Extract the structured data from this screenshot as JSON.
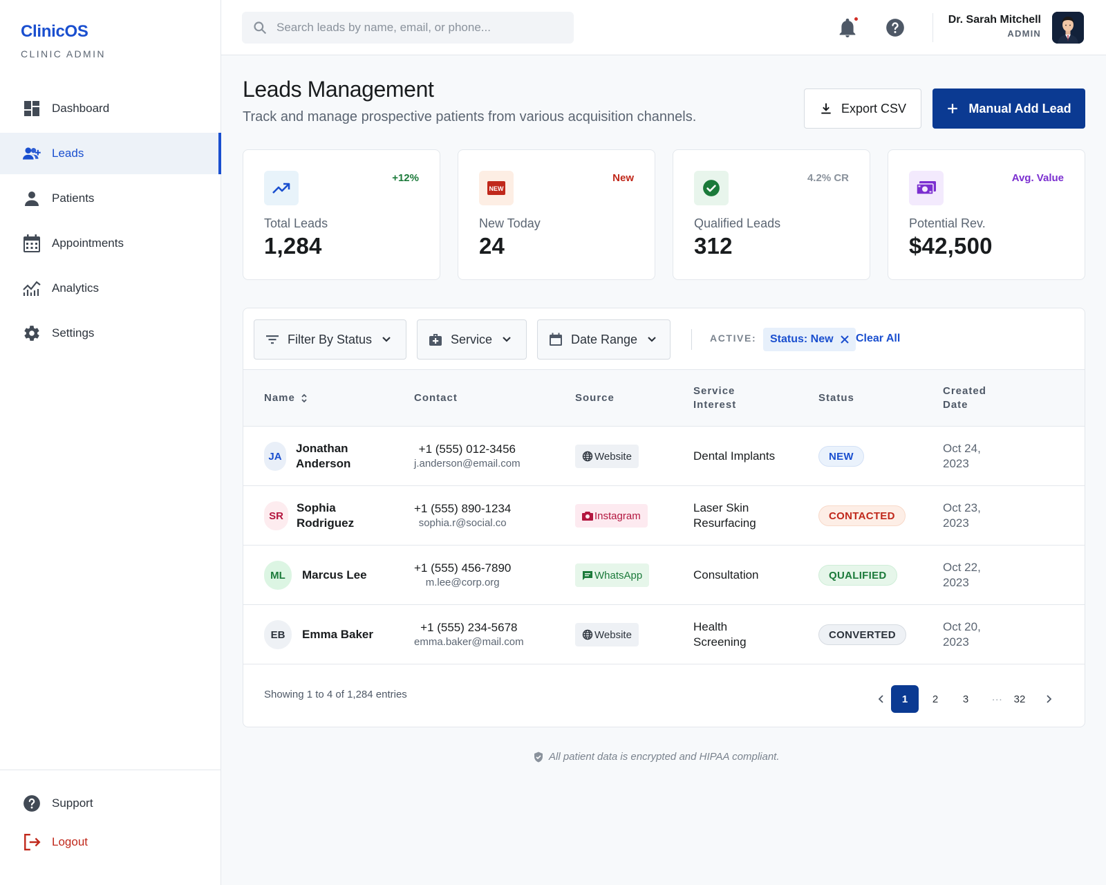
{
  "brand": {
    "title": "ClinicOS",
    "subtitle": "CLINIC ADMIN"
  },
  "sidebar": {
    "items": [
      {
        "label": "Dashboard",
        "icon": "dashboard-icon"
      },
      {
        "label": "Leads",
        "icon": "group-add-icon",
        "active": true
      },
      {
        "label": "Patients",
        "icon": "person-icon"
      },
      {
        "label": "Appointments",
        "icon": "calendar-icon"
      },
      {
        "label": "Analytics",
        "icon": "analytics-icon"
      },
      {
        "label": "Settings",
        "icon": "gear-icon"
      }
    ],
    "bottom": [
      {
        "label": "Support",
        "icon": "help-icon"
      },
      {
        "label": "Logout",
        "icon": "logout-icon"
      }
    ]
  },
  "topbar": {
    "search_placeholder": "Search leads by name, email, or phone...",
    "user_name": "Dr. Sarah Mitchell",
    "user_role": "ADMIN"
  },
  "header": {
    "title": "Leads Management",
    "subtitle": "Track and manage prospective patients from various acquisition channels.",
    "export_label": "Export CSV",
    "add_label": "Manual Add Lead"
  },
  "stats": [
    {
      "label": "Total Leads",
      "value": "1,284",
      "badge": "+12%",
      "badge_color": "#1b7a3a",
      "icon": "trending-up-icon",
      "icon_bg": "#e8f3fa",
      "icon_color": "#1a4fcf"
    },
    {
      "label": "New Today",
      "value": "24",
      "badge": "New",
      "badge_color": "#c0281b",
      "icon": "new-icon",
      "icon_bg": "#fdeee4",
      "icon_color": "#c0281b"
    },
    {
      "label": "Qualified Leads",
      "value": "312",
      "badge": "4.2% CR",
      "badge_color": "#8a929c",
      "icon": "check-circle-icon",
      "icon_bg": "#e8f5ec",
      "icon_color": "#1b7a3a"
    },
    {
      "label": "Potential Rev.",
      "value": "$42,500",
      "badge": "Avg. Value",
      "badge_color": "#7b2fd0",
      "icon": "payments-icon",
      "icon_bg": "#f3eafd",
      "icon_color": "#7b2fd0"
    }
  ],
  "filters": {
    "status_label": "Filter By Status",
    "service_label": "Service",
    "date_label": "Date Range",
    "active_label": "ACTIVE:",
    "chip_label": "Status: New",
    "clear_label": "Clear All"
  },
  "table": {
    "headers": {
      "name": "Name",
      "contact": "Contact",
      "source": "Source",
      "service_1": "Service",
      "service_2": "Interest",
      "status": "Status",
      "created_1": "Created",
      "created_2": "Date"
    },
    "rows": [
      {
        "initials": "JA",
        "name_1": "Jonathan",
        "name_2": "Anderson",
        "phone": "+1 (555) 012-3456",
        "email": "j.anderson@email.com",
        "source": "Website",
        "service_1": "Dental Implants",
        "service_2": "",
        "status": "NEW",
        "date_1": "Oct 24,",
        "date_2": "2023"
      },
      {
        "initials": "SR",
        "name_1": "Sophia",
        "name_2": "Rodriguez",
        "phone": "+1 (555) 890-1234",
        "email": "sophia.r@social.co",
        "source": "Instagram",
        "service_1": "Laser Skin",
        "service_2": "Resurfacing",
        "status": "CONTACTED",
        "date_1": "Oct 23,",
        "date_2": "2023"
      },
      {
        "initials": "ML",
        "name_1": "Marcus Lee",
        "name_2": "",
        "phone": "+1 (555) 456-7890",
        "email": "m.lee@corp.org",
        "source": "WhatsApp",
        "service_1": "Consultation",
        "service_2": "",
        "status": "QUALIFIED",
        "date_1": "Oct 22,",
        "date_2": "2023"
      },
      {
        "initials": "EB",
        "name_1": "Emma Baker",
        "name_2": "",
        "phone": "+1 (555) 234-5678",
        "email": "emma.baker@mail.com",
        "source": "Website",
        "service_1": "Health",
        "service_2": "Screening",
        "status": "CONVERTED",
        "date_1": "Oct 20,",
        "date_2": "2023"
      }
    ],
    "showing": "Showing 1 to 4 of 1,284 entries",
    "pages": [
      "1",
      "2",
      "3",
      "32"
    ],
    "ellipsis": "...",
    "current_page": "1"
  },
  "footer_note": "All patient data is encrypted and HIPAA compliant."
}
